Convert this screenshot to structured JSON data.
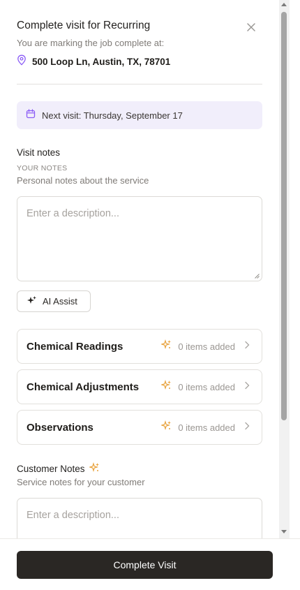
{
  "header": {
    "title": "Complete visit for Recurring",
    "subtitle": "You are marking the job complete at:",
    "address": "500 Loop Ln, Austin, TX, 78701"
  },
  "next_visit": {
    "text": "Next visit: Thursday, September 17"
  },
  "visit_notes": {
    "title": "Visit notes",
    "caption": "YOUR NOTES",
    "subtitle": "Personal notes about the service",
    "placeholder": "Enter a description...",
    "value": ""
  },
  "ai_assist": {
    "label": "AI Assist"
  },
  "cards": [
    {
      "title": "Chemical Readings",
      "count": "0 items added"
    },
    {
      "title": "Chemical Adjustments",
      "count": "0 items added"
    },
    {
      "title": "Observations",
      "count": "0 items added"
    }
  ],
  "customer_notes": {
    "title": "Customer Notes",
    "subtitle": "Service notes for your customer",
    "placeholder": "Enter a description..."
  },
  "footer": {
    "complete_label": "Complete Visit"
  },
  "colors": {
    "accent_purple": "#8b5cf6",
    "sparkle_orange": "#e8a13a",
    "primary_dark": "#2a2724",
    "next_visit_bg": "#f1eefb"
  },
  "icons": {
    "close": "close-icon",
    "location": "map-pin-icon",
    "calendar": "calendar-icon",
    "sparkles": "sparkles-icon",
    "chevron": "chevron-right-icon"
  }
}
